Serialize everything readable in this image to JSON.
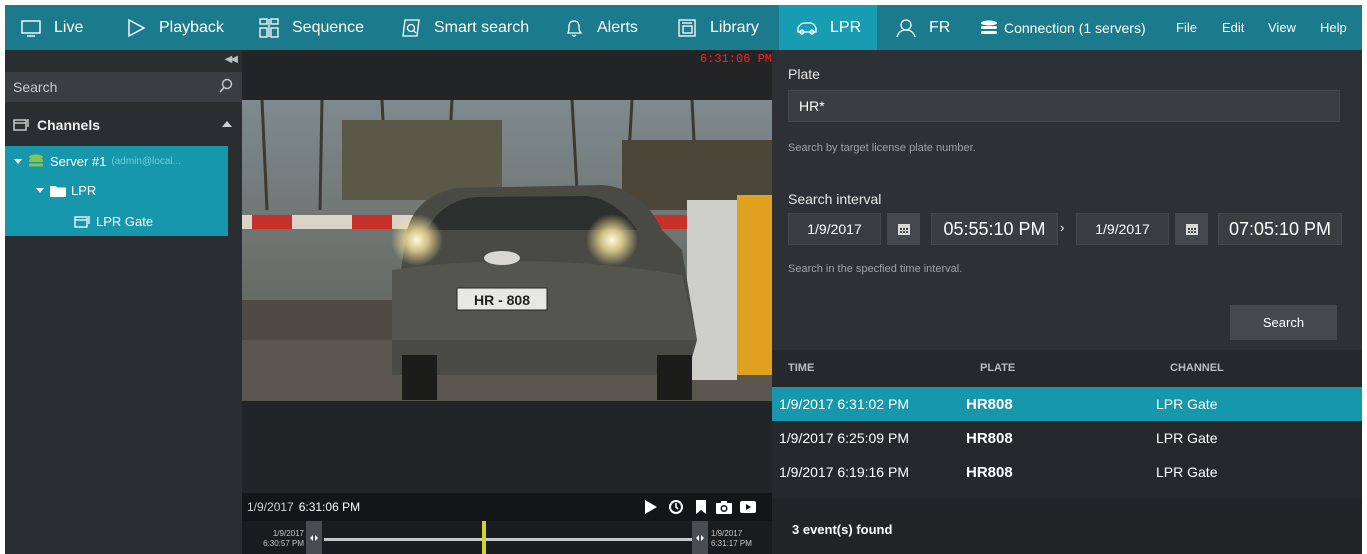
{
  "topbar": {
    "nav": [
      {
        "label": "Live",
        "icon": "monitor-icon"
      },
      {
        "label": "Playback",
        "icon": "play-icon"
      },
      {
        "label": "Sequence",
        "icon": "grid-icon"
      },
      {
        "label": "Smart search",
        "icon": "smart-search-icon"
      },
      {
        "label": "Alerts",
        "icon": "bell-icon"
      },
      {
        "label": "Library",
        "icon": "library-icon"
      },
      {
        "label": "LPR",
        "icon": "car-icon",
        "active": true
      },
      {
        "label": "FR",
        "icon": "face-icon"
      },
      {
        "label": "Connection (1 servers)",
        "icon": "server-stack-icon"
      }
    ],
    "menu": [
      "File",
      "Edit",
      "View",
      "Help"
    ],
    "active_color": "#179cb2",
    "bar_color": "#1b7a8b"
  },
  "left_panel": {
    "search_placeholder": "Search",
    "channels_title": "Channels",
    "tree": {
      "server_label": "Server #1",
      "server_user": "(admin@local...",
      "folder_label": "LPR",
      "channel_label": "LPR Gate"
    },
    "selection_color": "#1697ab"
  },
  "video": {
    "overlay_time": "6:31:06 PM",
    "current_date": "1/9/2017",
    "current_time": "6:31:06 PM",
    "timeline_start_date": "1/9/2017",
    "timeline_start_time": "6:30:57 PM",
    "timeline_end_date": "1/9/2017",
    "timeline_end_time": "6:31:17 PM",
    "plate_text": "HR - 808"
  },
  "lpr": {
    "plate_label": "Plate",
    "plate_value": "HR*",
    "plate_hint": "Search by target license plate number.",
    "interval_label": "Search interval",
    "from_date": "1/9/2017",
    "from_time": "05:55:10 PM",
    "to_date": "1/9/2017",
    "to_time": "07:05:10 PM",
    "interval_hint": "Search in the specfied time interval.",
    "search_button": "Search",
    "columns": [
      "TIME",
      "PLATE",
      "CHANNEL"
    ],
    "results": [
      {
        "time": "1/9/2017 6:31:02 PM",
        "plate": "HR808",
        "channel": "LPR Gate",
        "selected": true
      },
      {
        "time": "1/9/2017 6:25:09 PM",
        "plate": "HR808",
        "channel": "LPR Gate",
        "selected": false
      },
      {
        "time": "1/9/2017 6:19:16 PM",
        "plate": "HR808",
        "channel": "LPR Gate",
        "selected": false
      }
    ],
    "events_found": "3 event(s) found"
  }
}
